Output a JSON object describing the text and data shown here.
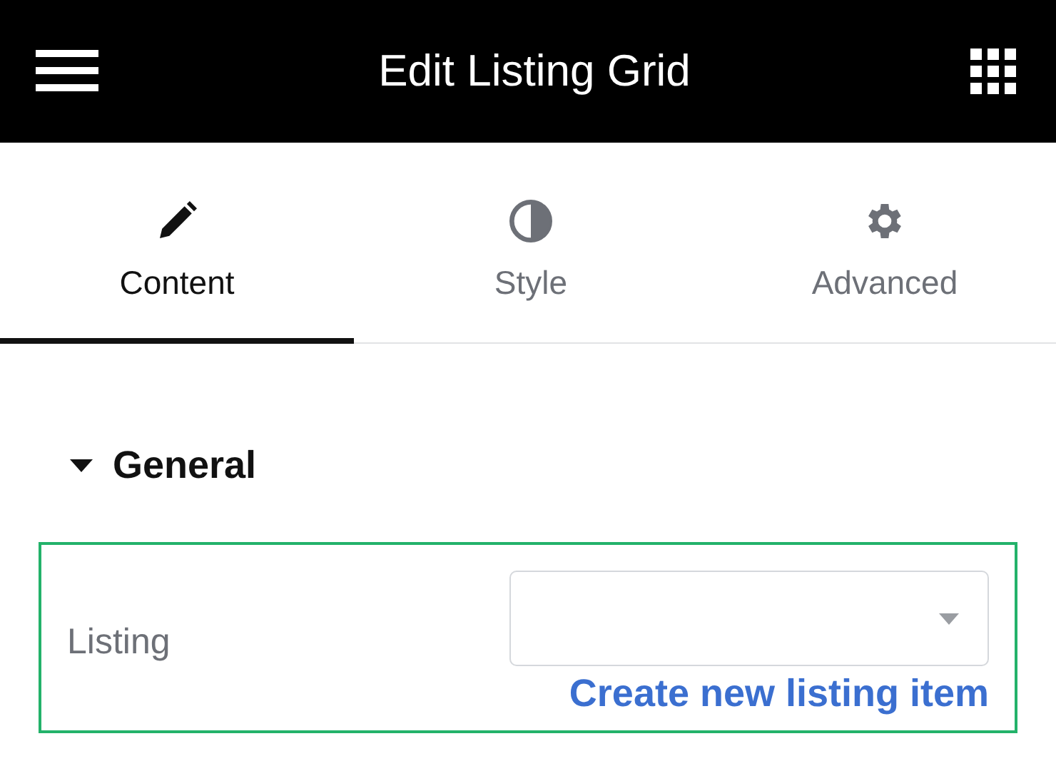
{
  "header": {
    "title": "Edit Listing Grid"
  },
  "tabs": [
    {
      "label": "Content",
      "selected": true
    },
    {
      "label": "Style",
      "selected": false
    },
    {
      "label": "Advanced",
      "selected": false
    }
  ],
  "section": {
    "title": "General",
    "expanded": true,
    "fields": [
      {
        "label": "Listing",
        "highlighted": true,
        "link": "Create new listing item"
      }
    ]
  }
}
